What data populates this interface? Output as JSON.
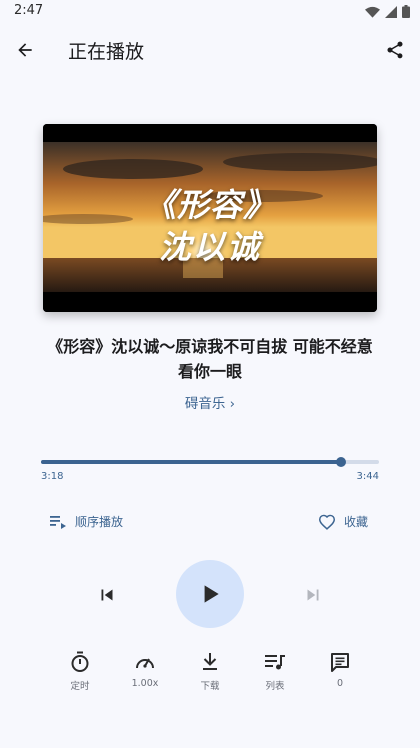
{
  "status_bar": {
    "time": "2:47"
  },
  "app_bar": {
    "title": "正在播放"
  },
  "cover": {
    "line1": "《形容》",
    "line2": "沈以诚"
  },
  "song": {
    "title": "《形容》沈以诚～原谅我不可自拔 可能不经意看你一眼",
    "artist": "碍音乐 ›"
  },
  "progress": {
    "current": "3:18",
    "total": "3:44",
    "fraction": 0.887
  },
  "controls": {
    "mode_label": "顺序播放",
    "favorite_label": "收藏"
  },
  "tools": {
    "timer_label": "定时",
    "speed_label": "1.00x",
    "download_label": "下载",
    "playlist_label": "列表",
    "comments_label": "0"
  },
  "colors": {
    "accent": "#3b6390",
    "play_bg": "#d4e3fb",
    "track": "#d3dbe9"
  }
}
